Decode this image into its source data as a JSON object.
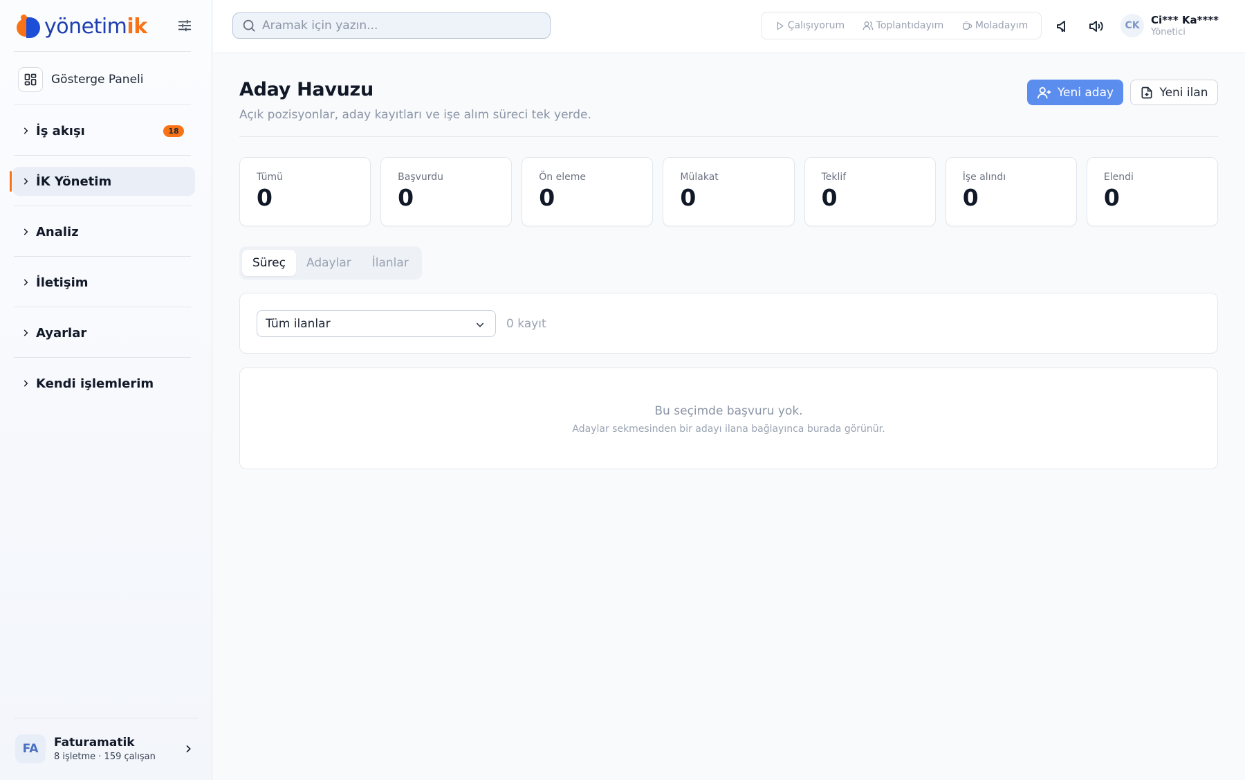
{
  "brand": {
    "part1": "yönetim",
    "part2": "ik"
  },
  "sidebar": {
    "dashboard_label": "Gösterge Paneli",
    "items": [
      {
        "label": "İş akışı",
        "badge": "18"
      },
      {
        "label": "İK Yönetim"
      },
      {
        "label": "Analiz"
      },
      {
        "label": "İletişim"
      },
      {
        "label": "Ayarlar"
      },
      {
        "label": "Kendi işlemlerim"
      }
    ],
    "org": {
      "initials": "FA",
      "name": "Faturamatik",
      "meta": "8 işletme · 159 çalışan"
    }
  },
  "topbar": {
    "search_placeholder": "Aramak için yazın...",
    "status": [
      {
        "label": "Çalışıyorum",
        "icon": "play-icon"
      },
      {
        "label": "Toplantıdayım",
        "icon": "users-icon"
      },
      {
        "label": "Moladayım",
        "icon": "coffee-icon"
      }
    ],
    "user": {
      "initials": "CK",
      "name": "Ci*** Ka****",
      "role": "Yönetici"
    }
  },
  "page": {
    "title": "Aday Havuzu",
    "subtitle": "Açık pozisyonlar, aday kayıtları ve işe alım süreci tek yerde.",
    "new_candidate": "Yeni aday",
    "new_posting": "Yeni ilan"
  },
  "stats": [
    {
      "label": "Tümü",
      "value": "0"
    },
    {
      "label": "Başvurdu",
      "value": "0"
    },
    {
      "label": "Ön eleme",
      "value": "0"
    },
    {
      "label": "Mülakat",
      "value": "0"
    },
    {
      "label": "Teklif",
      "value": "0"
    },
    {
      "label": "İşe alındı",
      "value": "0"
    },
    {
      "label": "Elendi",
      "value": "0"
    }
  ],
  "tabs": [
    {
      "label": "Süreç",
      "active": true
    },
    {
      "label": "Adaylar",
      "active": false
    },
    {
      "label": "İlanlar",
      "active": false
    }
  ],
  "filter": {
    "selected": "Tüm ilanlar",
    "count": "0 kayıt"
  },
  "empty": {
    "title": "Bu seçimde başvuru yok.",
    "subtitle": "Adaylar sekmesinden bir adayı ilana bağlayınca burada görünür."
  },
  "colors": {
    "accent": "#5b8def",
    "brand_orange": "#f97316",
    "brand_blue": "#1e40af"
  }
}
